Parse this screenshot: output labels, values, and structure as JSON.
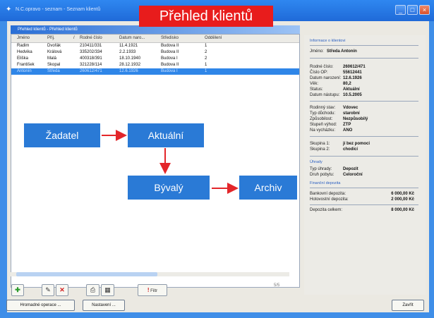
{
  "window": {
    "title": "N.C.opravo - seznam - Seznam klientů",
    "win_buttons": [
      "_",
      "□",
      "×"
    ]
  },
  "banner": "Přehled klientů",
  "subtitle": "Přehled klientů - Přehled klientů",
  "grid": {
    "columns": [
      "Jméno",
      "Příj.",
      "/",
      "Rodné číslo",
      "Datum naro...",
      "Středisko",
      "Oddělení"
    ],
    "rows": [
      [
        "Radim",
        "Dvořák",
        "210411/331",
        "11.4.1921",
        "Budova II",
        "1"
      ],
      [
        "Hedvika",
        "Králová",
        "335202/334",
        "2.2.1933",
        "Budova II",
        "2"
      ],
      [
        "Eliška",
        "Malá",
        "400318/391",
        "18.10.1940",
        "Budova I",
        "2"
      ],
      [
        "František",
        "Skopal",
        "321228/114",
        "28.12.1932",
        "Budova II",
        "1"
      ],
      [
        "Antonín",
        "Středa",
        "260612/471",
        "12.6.1926",
        "Budova I",
        "1"
      ]
    ]
  },
  "flow": {
    "zadatel": "Žadatel",
    "aktualni": "Aktuální",
    "byvaly": "Bývalý",
    "archiv": "Archiv"
  },
  "panel": {
    "header": "Informace o klientovi",
    "name_label": "Jméno:",
    "name_value": "Středa Antonín",
    "fields": [
      {
        "label": "Rodné číslo:",
        "value": "260612/471"
      },
      {
        "label": "Číslo OP:",
        "value": "55612441"
      },
      {
        "label": "Datum narození:",
        "value": "12.6.1926"
      },
      {
        "label": "Věk:",
        "value": "80,2"
      },
      {
        "label": "Status:",
        "value": "Aktuální"
      },
      {
        "label": "Datum nástupu:",
        "value": "10.5.2005"
      }
    ],
    "fields2": [
      {
        "label": "Rodinný stav:",
        "value": "Vdovec"
      },
      {
        "label": "Typ důchodu:",
        "value": "starobní"
      },
      {
        "label": "Způsobilost:",
        "value": "Nezpůsobilý"
      },
      {
        "label": "Stupeň výhod:",
        "value": "ZTP"
      },
      {
        "label": "Na vycházku:",
        "value": "ANO"
      }
    ],
    "fields3": [
      {
        "label": "Skupina 1:",
        "value": "jí bez pomoci"
      },
      {
        "label": "Skupina 2:",
        "value": "chodící"
      }
    ],
    "uhrady_header": "Úhrady",
    "uhrady": [
      {
        "label": "Typ úhrady:",
        "value": "Depozit"
      },
      {
        "label": "Druh pobytu:",
        "value": "Celoroční"
      }
    ],
    "depozita_header": "Finanční depozita",
    "depozita": [
      {
        "label": "Bankovní depozita:",
        "value": "6 000,00 Kč"
      },
      {
        "label": "Hotovostní depozita:",
        "value": "2 000,00 Kč"
      }
    ],
    "total_label": "Depozita celkem:",
    "total_value": "8 000,00 Kč"
  },
  "toolbar": {
    "add": "✚",
    "edit": "✎",
    "delete": "✕",
    "print": "⎙",
    "grid": "▦",
    "filter": "Filtr",
    "counter": "5/5"
  },
  "bottom": {
    "global_ops": "Hromadné operace ...",
    "settings": "Nastavení ...",
    "close": "Zavřít"
  }
}
